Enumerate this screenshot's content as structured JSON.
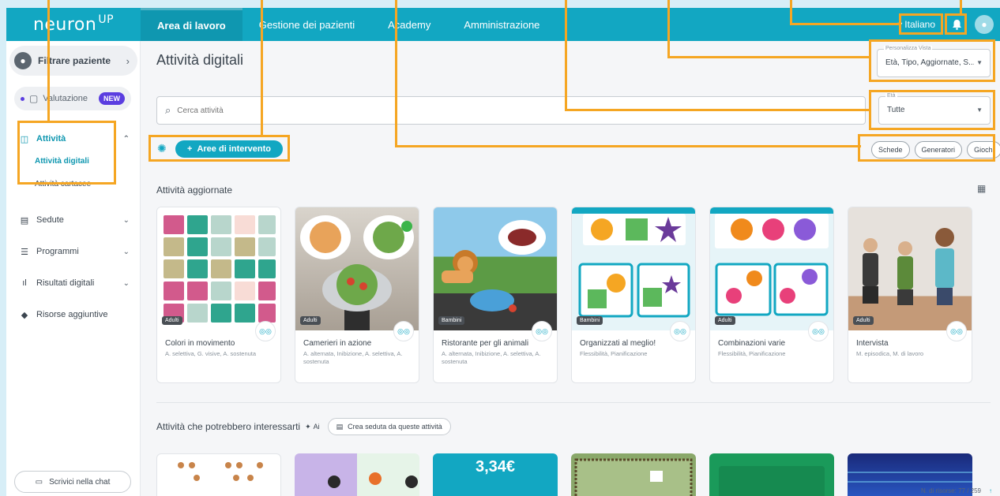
{
  "topbar": {
    "logo": "neuron",
    "logo_mark": "UP",
    "nav": [
      "Area di lavoro",
      "Gestione dei pazienti",
      "Academy",
      "Amministrazione"
    ],
    "language": "Italiano"
  },
  "sidebar": {
    "patient_filter": "Filtrare paziente",
    "valutazione": "Valutazione",
    "new_badge": "NEW",
    "attivita": "Attività",
    "attivita_digitali": "Attività digitali",
    "attivita_cartacee": "Attività cartacee",
    "sedute": "Sedute",
    "programmi": "Programmi",
    "risultati": "Risultati digitali",
    "risorse": "Risorse aggiuntive",
    "chat": "Scrivici nella chat"
  },
  "main": {
    "title": "Attività digitali",
    "view_label": "Personalizza Vista",
    "view_value": "Età, Tipo, Aggiornate, S...",
    "search_placeholder": "Cerca attività",
    "age_label": "Età",
    "age_value": "Tutte",
    "aree_button": "Aree di intervento",
    "chips": [
      "Schede",
      "Generatori",
      "Giochi"
    ],
    "section_updated": "Attività aggiornate",
    "section_ai": "Attività che potrebbero interessarti",
    "ai_tag": "Ai",
    "seduta_button": "Crea seduta da queste attività",
    "footer_count": "N. di risorse: 77 / 259"
  },
  "cards": [
    {
      "title": "Colori in movimento",
      "tags": "A. selettiva, G. visive, A. sostenuta",
      "age": "Adulti"
    },
    {
      "title": "Camerieri in azione",
      "tags": "A. alternata, Inibizione, A. selettiva, A. sostenuta",
      "age": "Adulti"
    },
    {
      "title": "Ristorante per gli animali",
      "tags": "A. alternata, Inibizione, A. selettiva, A. sostenuta",
      "age": "Bambini"
    },
    {
      "title": "Organizzati al meglio!",
      "tags": "Flessibilità, Pianificazione",
      "age": "Bambini"
    },
    {
      "title": "Combinazioni varie",
      "tags": "Flessibilità, Pianificazione",
      "age": "Adulti"
    },
    {
      "title": "Intervista",
      "tags": "M. episodica, M. di lavoro",
      "age": "Adulti"
    }
  ],
  "cards2_text": {
    "price": "3,34€"
  },
  "colors": {
    "primary": "#12a7c2",
    "accent": "#f5a623",
    "badge": "#5b3ee0"
  }
}
